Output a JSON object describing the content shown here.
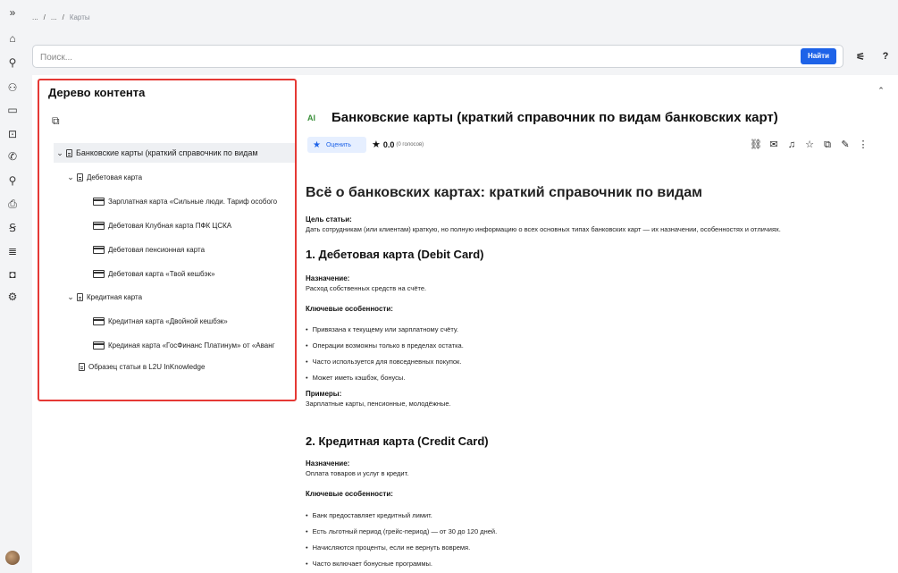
{
  "rail": {
    "icons": [
      "chevrons-right-icon",
      "home-icon",
      "search-icon",
      "user-icon",
      "card-icon",
      "lock-icon",
      "phone-icon",
      "person-pin-icon",
      "print-icon",
      "dollar-icon",
      "database-icon",
      "wallet-icon",
      "settings-icon"
    ],
    "glyphs": [
      "»",
      "⌂",
      "⚲",
      "⚇",
      "▭",
      "⊡",
      "✆",
      "⚲",
      "⎙",
      "Ꞩ",
      "≣",
      "◘",
      "⚙"
    ]
  },
  "breadcrumb": {
    "items": [
      "...",
      "/",
      "...",
      "/"
    ],
    "current": "Карты"
  },
  "search": {
    "placeholder": "Поиск...",
    "value": "",
    "button": "Найти"
  },
  "toolbar": {
    "filter_glyph": "⚟",
    "help_glyph": "?"
  },
  "tree": {
    "title": "Дерево контента",
    "root": "Банковские карты (краткий справочник по видам",
    "groups": [
      {
        "label": "Дебетовая карта",
        "items": [
          "Зарплатная карта «Сильные люди. Тариф особого",
          "Дебетовая Клубная карта ПФК ЦСКА",
          "Дебетовая пенсионная карта",
          "Дебетовая карта «Твой кешбэк»"
        ]
      },
      {
        "label": "Кредитная карта",
        "items": [
          "Кредитная карта «Двойной кешбэк»",
          "Крединая карта «ГосФинанс Платинум» от «Аванг"
        ]
      }
    ],
    "extra": "Образец статьи в L2U InKnowledge"
  },
  "article": {
    "ai_badge": "AI",
    "title": "Банковские карты (краткий справочник по видам банковских карт)",
    "rate_button": "Оценить",
    "rating": "0.0",
    "votes": "(0 голосов)",
    "h1": "Всё о банковских картах: краткий справочник по видам",
    "goal_label": "Цель статьи:",
    "goal_text": "Дать сотрудникам (или клиентам) краткую, но полную информацию о всех основных типах банковских карт — их назначении, особенностях и отличиях.",
    "s1": {
      "title": "1. Дебетовая карта (Debit Card)",
      "purpose_label": "Назначение:",
      "purpose_text": "Расход собственных средств на счёте.",
      "features_label": "Ключевые особенности:",
      "features": [
        "Привязана к текущему или зарплатному счёту.",
        "Операции возможны только в пределах остатка.",
        "Часто используется для повседневных покупок.",
        "Может иметь кэшбэк, бонусы."
      ],
      "examples_label": "Примеры:",
      "examples_text": "Зарплатные карты, пенсионные, молодёжные."
    },
    "s2": {
      "title": "2. Кредитная карта (Credit Card)",
      "purpose_label": "Назначение:",
      "purpose_text": "Оплата товаров и услуг в кредит.",
      "features_label": "Ключевые особенности:",
      "features": [
        "Банк предоставляет кредитный лимит.",
        "Есть льготный период (грейс-период) — от 30 до 120 дней.",
        "Начисляются проценты, если не вернуть вовремя.",
        "Часто включает бонусные программы."
      ]
    }
  }
}
